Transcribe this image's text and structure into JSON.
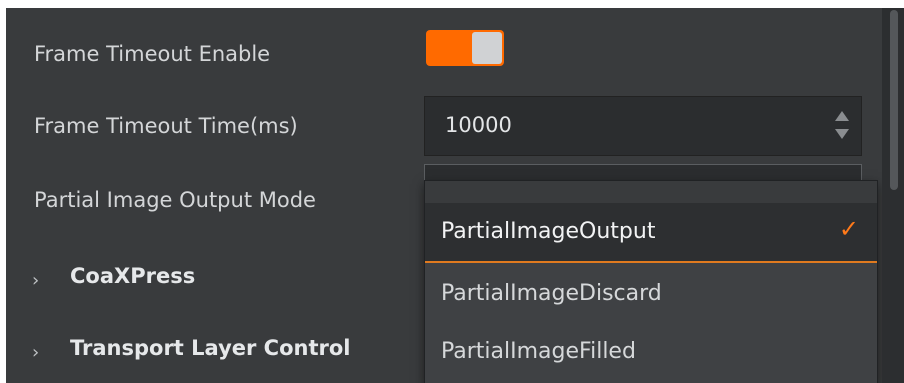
{
  "rows": {
    "frame_timeout_enable": {
      "label": "Frame Timeout Enable",
      "toggle_on": true
    },
    "frame_timeout_time": {
      "label": "Frame Timeout Time(ms)",
      "value": "10000"
    },
    "partial_image_output_mode": {
      "label": "Partial Image Output Mode"
    }
  },
  "sections": [
    {
      "label": "CoaXPress"
    },
    {
      "label": "Transport Layer Control"
    }
  ],
  "dropdown": {
    "options": [
      {
        "label": "PartialImageOutput",
        "selected": true
      },
      {
        "label": "PartialImageDiscard",
        "selected": false
      },
      {
        "label": "PartialImageFilled",
        "selected": false
      }
    ]
  },
  "icons": {
    "expand": "chevron-right-icon",
    "check": "checkmark-icon",
    "spin_up": "spin-up-arrow-icon",
    "spin_down": "spin-down-arrow-icon"
  },
  "colors": {
    "panel_bg": "#393b3d",
    "accent": "#ff6a00",
    "text": "#d4d6d8"
  }
}
